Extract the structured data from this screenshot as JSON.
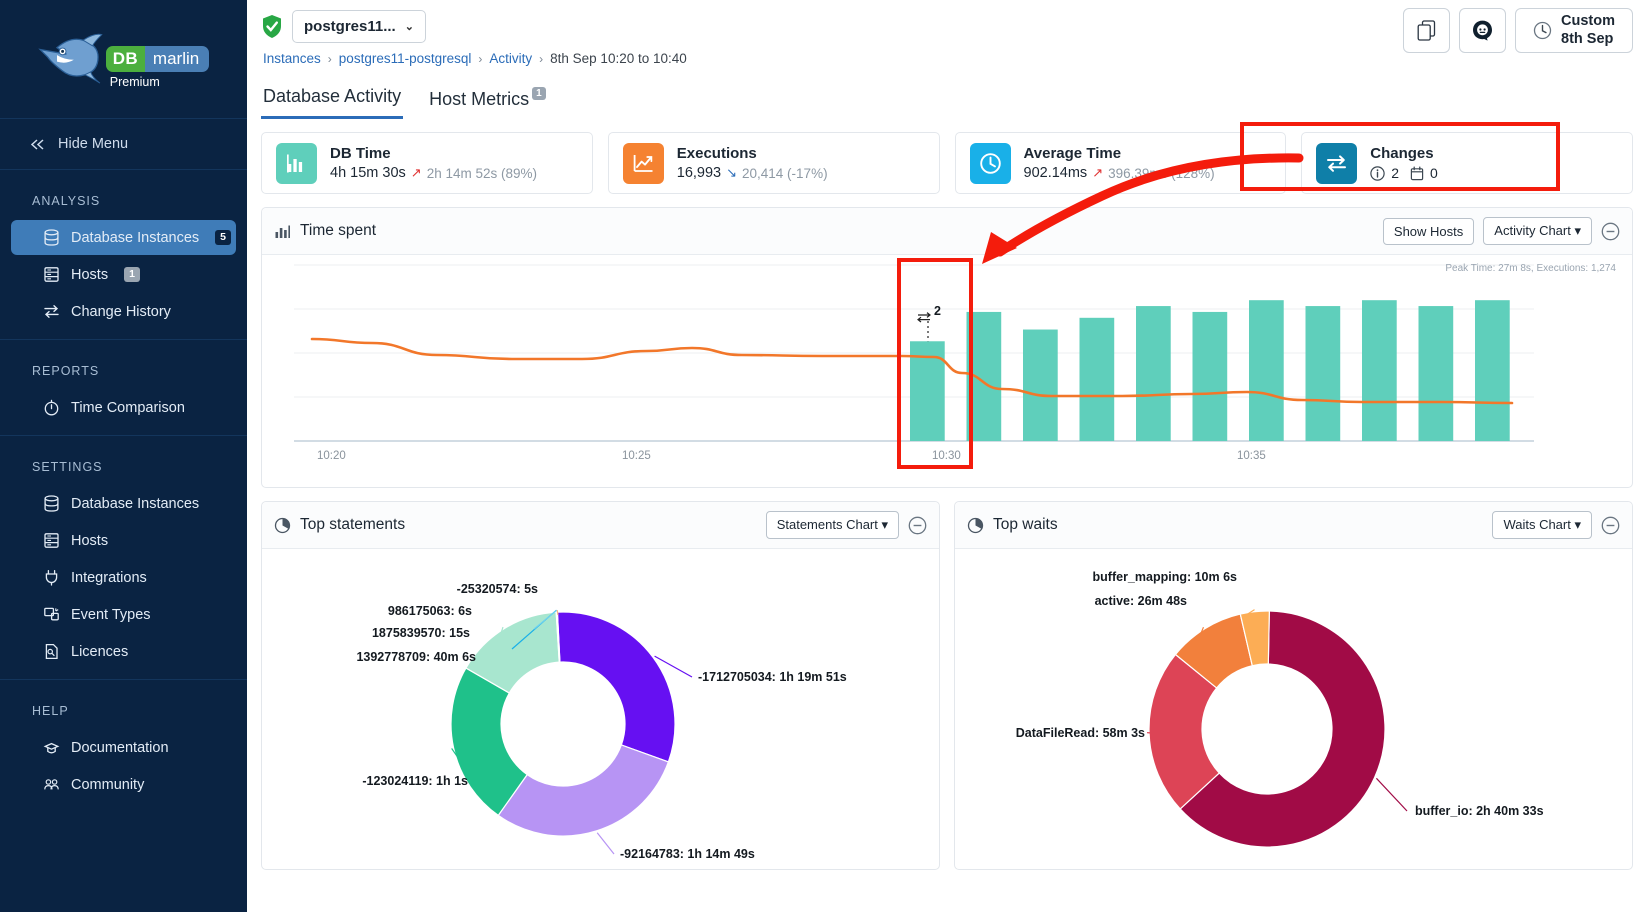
{
  "sidebar": {
    "brand": {
      "db": "DB",
      "marlin": "marlin",
      "tier": "Premium"
    },
    "hide_menu": "Hide Menu",
    "groups": [
      {
        "title": "ANALYSIS",
        "items": [
          {
            "label": "Database Instances",
            "icon": "database-icon",
            "badge": "5",
            "active": true
          },
          {
            "label": "Hosts",
            "icon": "server-icon",
            "badge": "1",
            "active": false
          },
          {
            "label": "Change History",
            "icon": "exchange-icon",
            "badge": "",
            "active": false
          }
        ]
      },
      {
        "title": "REPORTS",
        "items": [
          {
            "label": "Time Comparison",
            "icon": "stopwatch-icon",
            "badge": "",
            "active": false
          }
        ]
      },
      {
        "title": "SETTINGS",
        "items": [
          {
            "label": "Database Instances",
            "icon": "database-icon",
            "badge": "",
            "active": false
          },
          {
            "label": "Hosts",
            "icon": "server-icon",
            "badge": "",
            "active": false
          },
          {
            "label": "Integrations",
            "icon": "plug-icon",
            "badge": "",
            "active": false
          },
          {
            "label": "Event Types",
            "icon": "event-icon",
            "badge": "",
            "active": false
          },
          {
            "label": "Licences",
            "icon": "licence-icon",
            "badge": "",
            "active": false
          }
        ]
      },
      {
        "title": "HELP",
        "items": [
          {
            "label": "Documentation",
            "icon": "book-icon",
            "badge": "",
            "active": false
          },
          {
            "label": "Community",
            "icon": "people-icon",
            "badge": "",
            "active": false
          }
        ]
      }
    ]
  },
  "header": {
    "instance_selector": "postgres11...",
    "breadcrumb": [
      {
        "label": "Instances",
        "link": true
      },
      {
        "label": "postgres11-postgresql",
        "link": true
      },
      {
        "label": "Activity",
        "link": true
      },
      {
        "label": "8th Sep 10:20 to 10:40",
        "link": false
      }
    ],
    "actions": {
      "copy": "copy-icon",
      "bot": "bot-icon",
      "date_line1": "Custom",
      "date_line2": "8th Sep"
    }
  },
  "tabs": [
    {
      "label": "Database Activity",
      "badge": "",
      "active": true
    },
    {
      "label": "Host Metrics",
      "badge": "1",
      "active": false
    }
  ],
  "kpis": [
    {
      "title": "DB Time",
      "value": "4h 15m 30s",
      "trend": "up",
      "compare": "2h 14m 52s (89%)",
      "color": "#5fcfbb",
      "icon": "bar-chart-icon"
    },
    {
      "title": "Executions",
      "value": "16,993",
      "trend": "down",
      "compare": "20,414 (-17%)",
      "color": "#f58231",
      "icon": "line-chart-icon"
    },
    {
      "title": "Average Time",
      "value": "902.14ms",
      "trend": "up",
      "compare": "396.39ms (128%)",
      "color": "#19b0e8",
      "icon": "clock-icon"
    },
    {
      "title": "Changes",
      "value": "",
      "trend": "",
      "compare": "",
      "color": "#0f7fa8",
      "icon": "exchange-icon",
      "info_count": "2",
      "calendar_count": "0"
    }
  ],
  "time_spent": {
    "title": "Time spent",
    "show_hosts": "Show Hosts",
    "chart_select": "Activity Chart",
    "peak_note": "Peak Time: 27m 8s, Executions: 1,274",
    "change_marker": "2"
  },
  "top_statements": {
    "title": "Top statements",
    "chart_select": "Statements Chart"
  },
  "top_waits": {
    "title": "Top waits",
    "chart_select": "Waits Chart"
  },
  "chart_data": [
    {
      "type": "bar",
      "title": "Time spent",
      "xlabel": "",
      "ylabel": "",
      "grid": true,
      "legend": "none",
      "x_ticks": [
        "10:20",
        "10:25",
        "10:30",
        "10:35"
      ],
      "categories": [
        "10:29",
        "10:30",
        "10:31",
        "10:32",
        "10:33",
        "10:34",
        "10:35",
        "10:36",
        "10:37",
        "10:38",
        "10:39"
      ],
      "series": [
        {
          "name": "Time spent",
          "type": "bar",
          "color": "#5fcfbb",
          "values": [
            17,
            22,
            19,
            21,
            23,
            22,
            24,
            23,
            24,
            23,
            24
          ]
        },
        {
          "name": "Executions",
          "type": "line",
          "color": "#f2772a",
          "values": [
            26,
            24,
            23,
            23,
            24,
            24,
            22,
            23,
            22,
            22,
            22
          ]
        }
      ],
      "annotations": [
        {
          "label": "2",
          "icon": "exchange-icon",
          "at": "10:30"
        }
      ]
    },
    {
      "type": "pie",
      "title": "Top statements",
      "labels": [
        "-1712705034: 1h 19m 51s",
        "-92164783: 1h 14m 49s",
        "-123024119: 1h 1s",
        "1392778709: 40m 6s",
        "1875839570: 15s",
        "986175063: 6s",
        "-25320574: 5s"
      ],
      "values": [
        4791,
        4489,
        3601,
        2406,
        15,
        6,
        5
      ],
      "colors": [
        "#6610f2",
        "#b794f4",
        "#1fc18a",
        "#a8e6cf",
        "#19b0e8",
        "#6fd3ef",
        "#f7b583"
      ]
    },
    {
      "type": "pie",
      "title": "Top waits",
      "labels": [
        "buffer_io: 2h 40m 33s",
        "DataFileRead: 58m 3s",
        "active: 26m 48s",
        "buffer_mapping: 10m 6s"
      ],
      "values": [
        9633,
        3483,
        1608,
        606
      ],
      "colors": [
        "#a10b46",
        "#dd4456",
        "#f2803c",
        "#fcad55"
      ]
    }
  ]
}
